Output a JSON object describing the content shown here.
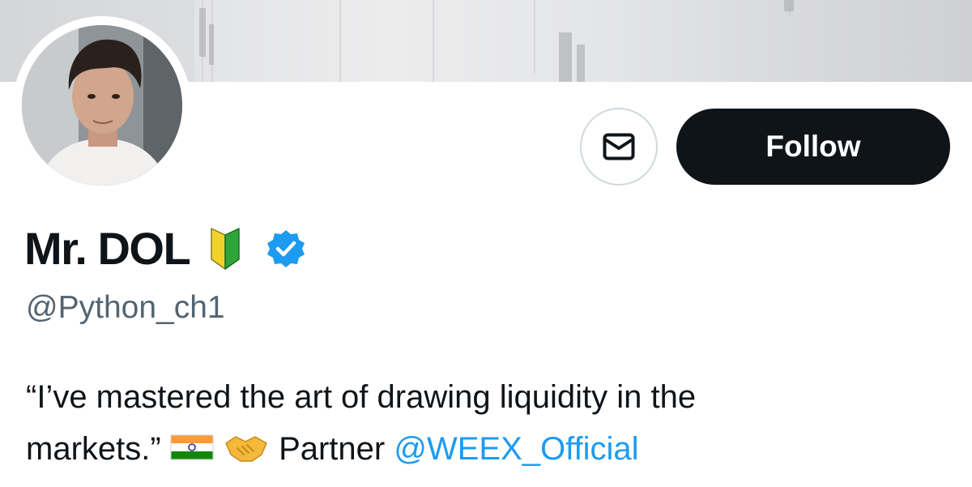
{
  "profile": {
    "display_name": "Mr. DOL",
    "handle": "@Python_ch1",
    "bio_line1": "“I’ve mastered the art of drawing liquidity in the",
    "bio_line2_text": "markets.”",
    "bio_partner_label": "Partner",
    "bio_mention": "@WEEX_Official"
  },
  "actions": {
    "follow_label": "Follow",
    "message_icon": "envelope-icon"
  },
  "badges": {
    "name_emoji": "beginner-symbol-icon",
    "verified": "verified-badge-icon"
  },
  "bio_emojis": [
    "india-flag-icon",
    "handshake-icon"
  ],
  "colors": {
    "text": "#0f1419",
    "secondary": "#536471",
    "link": "#1d9bf0",
    "button_dark": "#0f1419",
    "border": "#cfd9de",
    "verified": "#1d9bf0"
  }
}
